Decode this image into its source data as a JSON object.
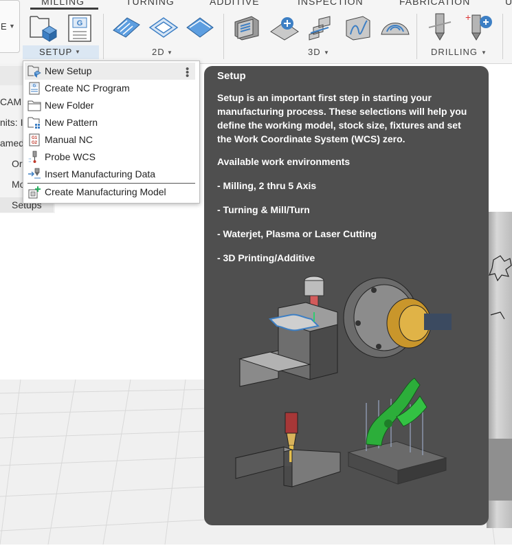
{
  "ribbon": {
    "tabs": [
      "MILLING",
      "TURNING",
      "ADDITIVE",
      "INSPECTION",
      "FABRICATION",
      "U"
    ],
    "workspace_switch_label": "E",
    "groups": {
      "setup": "SETUP",
      "two_d": "2D",
      "three_d": "3D",
      "drilling": "DRILLING"
    }
  },
  "browser": {
    "rows": [
      "CAM I",
      "nits: I",
      "amed",
      "Or",
      "Mo",
      "Setups"
    ]
  },
  "menu": {
    "items": [
      {
        "label": "New Setup",
        "icon": "new-setup-icon"
      },
      {
        "label": "Create NC Program",
        "icon": "nc-program-icon"
      },
      {
        "label": "New Folder",
        "icon": "folder-icon"
      },
      {
        "label": "New Pattern",
        "icon": "pattern-icon"
      },
      {
        "label": "Manual NC",
        "icon": "manual-nc-icon"
      },
      {
        "label": "Probe WCS",
        "icon": "probe-icon"
      },
      {
        "label": "Insert Manufacturing Data",
        "icon": "insert-data-icon"
      },
      {
        "label": "Create Manufacturing Model",
        "icon": "manufacturing-model-icon"
      }
    ]
  },
  "tooltip": {
    "title": "Setup",
    "body": "Setup is an important first step in starting your manufacturing process. These selections will help you define the working model, stock size, fixtures and set the Work Coordinate System (WCS) zero.",
    "environments_heading": "Available work environments",
    "environments": [
      "- Milling, 2 thru 5 Axis",
      "- Turning & Mill/Turn",
      "- Waterjet, Plasma or Laser Cutting",
      "- 3D Printing/Additive"
    ]
  },
  "colors": {
    "tooltip_bg": "#4f4f4f",
    "ribbon_bg": "#f5f5f5",
    "accent_blue": "#2f7fd0",
    "menu_highlight": "#ececec"
  }
}
